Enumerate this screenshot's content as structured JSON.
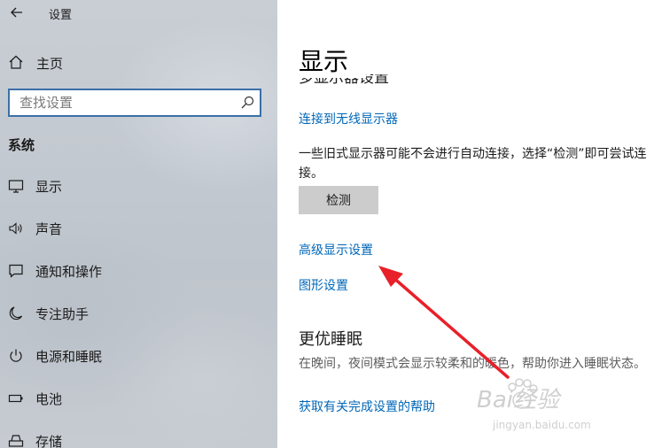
{
  "window": {
    "title": "设置"
  },
  "sidebar": {
    "home_label": "主页",
    "search": {
      "placeholder": "查找设置",
      "value": ""
    },
    "section_title": "系统",
    "items": [
      {
        "label": "显示",
        "icon": "monitor-icon"
      },
      {
        "label": "声音",
        "icon": "speaker-icon"
      },
      {
        "label": "通知和操作",
        "icon": "notification-icon"
      },
      {
        "label": "专注助手",
        "icon": "moon-icon"
      },
      {
        "label": "电源和睡眠",
        "icon": "power-icon"
      },
      {
        "label": "电池",
        "icon": "battery-icon"
      },
      {
        "label": "存储",
        "icon": "storage-icon"
      }
    ]
  },
  "main": {
    "title": "显示",
    "clipped_heading": "多显示器设置",
    "connect_wireless_link": "连接到无线显示器",
    "old_display_text": "一些旧式显示器可能不会进行自动连接，选择“检测”即可尝试连接。",
    "detect_button": "检测",
    "advanced_display_link": "高级显示设置",
    "graphics_settings_link": "图形设置",
    "sleep_heading": "更优睡眠",
    "sleep_text": "在晚间，夜间模式会显示较柔和的暖色，帮助你进入睡眠状态。",
    "sleep_help_link": "获取有关完成设置的帮助"
  },
  "annotation": {
    "arrow_color": "#e8202a"
  },
  "watermark": {
    "brand_text": "Bai经验",
    "url_text": "jingyan.baidu.com"
  },
  "colors": {
    "link": "#0067b8",
    "search_border": "#3c6fa8",
    "button_bg": "#cccccc"
  }
}
